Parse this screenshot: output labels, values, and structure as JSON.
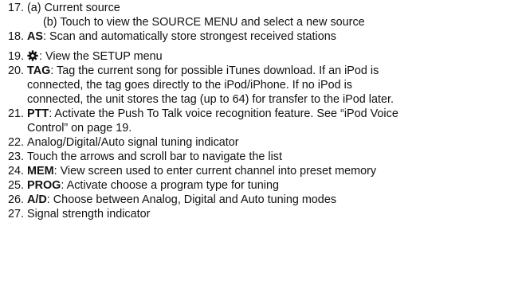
{
  "items": [
    {
      "num": "17.",
      "lines": [
        "(a) Current source",
        "(b) Touch to view the SOURCE MENU and select a new source"
      ]
    },
    {
      "num": "18.",
      "term": "AS",
      "text": ": Scan and automatically store strongest received stations"
    },
    {
      "num": "19.",
      "icon": "gear-icon",
      "text": ": View the SETUP menu"
    },
    {
      "num": "20.",
      "term": "TAG",
      "lines": [
        ": Tag the current song for possible iTunes download. If an iPod is",
        "connected, the tag goes directly to the iPod/iPhone. If no iPod is",
        "connected, the unit stores the tag (up to 64) for transfer to the iPod later."
      ]
    },
    {
      "num": "21.",
      "term": "PTT",
      "lines": [
        ": Activate the Push To Talk voice recognition feature. See “iPod Voice",
        "Control” on page 19."
      ]
    },
    {
      "num": "22.",
      "text": "Analog/Digital/Auto signal tuning indicator"
    },
    {
      "num": "23.",
      "text": "Touch the arrows and scroll bar to navigate the list"
    },
    {
      "num": "24.",
      "term": "MEM",
      "text": ": View screen used to enter current channel into preset memory"
    },
    {
      "num": "25.",
      "term": "PROG",
      "text": ": Activate choose a program type for tuning"
    },
    {
      "num": "26.",
      "term": "A/D",
      "text": ": Choose between Analog, Digital and Auto tuning modes"
    },
    {
      "num": "27.",
      "text": "Signal strength indicator"
    }
  ]
}
